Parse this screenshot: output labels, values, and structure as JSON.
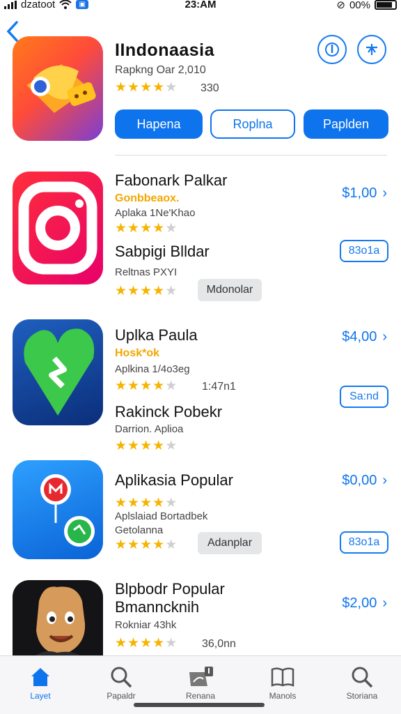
{
  "status_bar": {
    "carrier": "dzatoot",
    "time": "23:AM",
    "battery": "00%"
  },
  "header": {
    "title": "IIndonaasia",
    "subtitle": "Rapkng Oar 2,010",
    "rating": {
      "filled": 4,
      "total": 5
    },
    "count": "330",
    "buttons": [
      "Hapena",
      "Roplna",
      "Paplden"
    ]
  },
  "apps": [
    {
      "name": "Fabonark Palkar",
      "tag": "Gonbbeaox.",
      "sub": "Aplaka 1Ne'Khao",
      "rating1": 4,
      "name2": "Sabpigi Blldar",
      "sub2": "Reltnas PXYI",
      "rating2": 4,
      "price": "$1,00",
      "box_label": "83o1a",
      "grey_label": "Mdonolar",
      "icon": "camera-icon"
    },
    {
      "name": "Uplka Paula",
      "tag": "Hosk*ok",
      "sub": "Aplkina 1/4o3eg",
      "rating1": 4,
      "count": "1:47n1",
      "name2": "Rakinck Pobekr",
      "sub2": "Darrion.  Aplioa",
      "rating2": 4,
      "price": "$4,00",
      "box_label": "Sa:nd",
      "icon": "heart-bolt-icon"
    },
    {
      "name": "Aplikasia Popular",
      "sub": "Aplslaiad Bortadbek",
      "sub_b": "Getolanna",
      "rating1": 4,
      "rating2": 4,
      "price": "$0,00",
      "box_label": "83o1a",
      "grey_label": "Adanplar",
      "icon": "messenger-icon"
    },
    {
      "name": "Blpbodr Popular",
      "name_b": "Bmanncknih",
      "sub": "Rokniar 43hk",
      "rating1": 4,
      "count": "36,0nn",
      "price": "$2,00",
      "icon": "character-icon"
    }
  ],
  "tabs": [
    {
      "label": "Layet",
      "icon": "home-icon",
      "active": true
    },
    {
      "label": "Papaldr",
      "icon": "search-icon",
      "active": false
    },
    {
      "label": "Renana",
      "icon": "bookmark-badge-icon",
      "active": false
    },
    {
      "label": "Manols",
      "icon": "book-icon",
      "active": false
    },
    {
      "label": "Storiana",
      "icon": "search-icon",
      "active": false
    }
  ],
  "colors": {
    "accent": "#0e74ee",
    "star": "#f5b400",
    "tag": "#f2a700"
  }
}
